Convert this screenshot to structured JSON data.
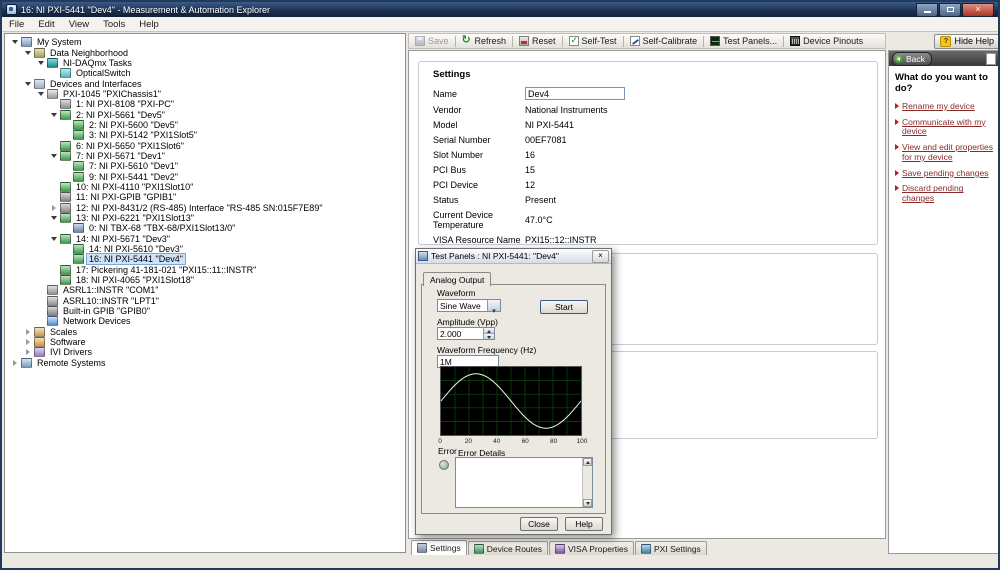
{
  "window": {
    "title": "16: NI PXI-5441 \"Dev4\" - Measurement & Automation Explorer"
  },
  "menu": {
    "items": [
      "File",
      "Edit",
      "View",
      "Tools",
      "Help"
    ]
  },
  "toolbar": {
    "save": "Save",
    "refresh": "Refresh",
    "reset": "Reset",
    "self_test": "Self-Test",
    "self_calibrate": "Self-Calibrate",
    "test_panels": "Test Panels...",
    "device_pinouts": "Device Pinouts"
  },
  "help": {
    "hide_help": "Hide Help",
    "back": "Back",
    "heading": "What do you want to do?",
    "links": [
      "Rename my device",
      "Communicate with my device",
      "View and edit properties for my device",
      "Save pending changes",
      "Discard pending changes"
    ]
  },
  "tree": {
    "items": [
      {
        "label": "My System",
        "depth": 0,
        "icon": "computer",
        "exp": "open"
      },
      {
        "label": "Data Neighborhood",
        "depth": 1,
        "icon": "folder-data",
        "exp": "open"
      },
      {
        "label": "NI-DAQmx Tasks",
        "depth": 2,
        "icon": "daqmx",
        "exp": "open"
      },
      {
        "label": "OpticalSwitch",
        "depth": 3,
        "icon": "task",
        "exp": "none"
      },
      {
        "label": "Devices and Interfaces",
        "depth": 1,
        "icon": "folder-devices",
        "exp": "open"
      },
      {
        "label": "PXI-1045 \"PXIChassis1\"",
        "depth": 2,
        "icon": "chassis",
        "exp": "open"
      },
      {
        "label": "1: NI PXI-8108 \"PXI-PC\"",
        "depth": 3,
        "icon": "controller",
        "exp": "none"
      },
      {
        "label": "2: NI PXI-5661 \"Dev5\"",
        "depth": 3,
        "icon": "board",
        "exp": "open"
      },
      {
        "label": "2: NI PXI-5600 \"Dev5\"",
        "depth": 4,
        "icon": "board",
        "exp": "none"
      },
      {
        "label": "3: NI PXI-5142 \"PXI1Slot5\"",
        "depth": 4,
        "icon": "board",
        "exp": "none"
      },
      {
        "label": "6: NI PXI-5650 \"PXI1Slot6\"",
        "depth": 3,
        "icon": "board",
        "exp": "none"
      },
      {
        "label": "7: NI PXI-5671 \"Dev1\"",
        "depth": 3,
        "icon": "board",
        "exp": "open"
      },
      {
        "label": "7: NI PXI-5610 \"Dev1\"",
        "depth": 4,
        "icon": "board",
        "exp": "none"
      },
      {
        "label": "9: NI PXI-5441 \"Dev2\"",
        "depth": 4,
        "icon": "board",
        "exp": "none"
      },
      {
        "label": "10: NI PXI-4110 \"PXI1Slot10\"",
        "depth": 3,
        "icon": "board",
        "exp": "none"
      },
      {
        "label": "11: NI PXI-GPIB \"GPIB1\"",
        "depth": 3,
        "icon": "gpib",
        "exp": "none"
      },
      {
        "label": "12: NI PXI-8431/2 (RS-485) Interface \"RS-485 SN:015F7E89\"",
        "depth": 3,
        "icon": "serial",
        "exp": "closed"
      },
      {
        "label": "13: NI PXI-6221 \"PXI1Slot13\"",
        "depth": 3,
        "icon": "board",
        "exp": "open"
      },
      {
        "label": "0: NI TBX-68 \"TBX-68/PXI1Slot13/0\"",
        "depth": 4,
        "icon": "accessory",
        "exp": "none"
      },
      {
        "label": "14: NI PXI-5671 \"Dev3\"",
        "depth": 3,
        "icon": "board",
        "exp": "open"
      },
      {
        "label": "14: NI PXI-5610 \"Dev3\"",
        "depth": 4,
        "icon": "board",
        "exp": "none"
      },
      {
        "label": "16: NI PXI-5441 \"Dev4\"",
        "depth": 4,
        "icon": "board",
        "exp": "none",
        "selected": true
      },
      {
        "label": "17: Pickering 41-181-021 \"PXI15::11::INSTR\"",
        "depth": 3,
        "icon": "board",
        "exp": "none"
      },
      {
        "label": "18: NI PXI-4065 \"PXI1Slot18\"",
        "depth": 3,
        "icon": "board",
        "exp": "none"
      },
      {
        "label": "ASRL1::INSTR \"COM1\"",
        "depth": 2,
        "icon": "serial-port",
        "exp": "none"
      },
      {
        "label": "ASRL10::INSTR \"LPT1\"",
        "depth": 2,
        "icon": "serial-port",
        "exp": "none"
      },
      {
        "label": "Built-in GPIB \"GPIB0\"",
        "depth": 2,
        "icon": "gpib",
        "exp": "none"
      },
      {
        "label": "Network Devices",
        "depth": 2,
        "icon": "network",
        "exp": "none"
      },
      {
        "label": "Scales",
        "depth": 1,
        "icon": "scales",
        "exp": "closed"
      },
      {
        "label": "Software",
        "depth": 1,
        "icon": "software",
        "exp": "closed"
      },
      {
        "label": "IVI Drivers",
        "depth": 1,
        "icon": "ivi",
        "exp": "closed"
      },
      {
        "label": "Remote Systems",
        "depth": 0,
        "icon": "remote",
        "exp": "closed"
      }
    ]
  },
  "settings": {
    "title": "Settings",
    "fields": [
      {
        "label": "Name",
        "value": "Dev4",
        "input": true
      },
      {
        "label": "Vendor",
        "value": "National Instruments"
      },
      {
        "label": "Model",
        "value": "NI PXI-5441"
      },
      {
        "label": "Serial Number",
        "value": "00EF7081"
      },
      {
        "label": "Slot Number",
        "value": "16"
      },
      {
        "label": "PCI Bus",
        "value": "15"
      },
      {
        "label": "PCI Device",
        "value": "12"
      },
      {
        "label": "Status",
        "value": "Present"
      },
      {
        "label": "Current Device Temperature",
        "value": "47.0°C"
      },
      {
        "label": "VISA Resource Name",
        "value": "PXI15::12::INSTR"
      }
    ]
  },
  "dialog": {
    "title": "Test Panels : NI PXI-5441: \"Dev4\"",
    "tab": "Analog Output",
    "waveform_label": "Waveform",
    "waveform_value": "Sine Wave",
    "start_button": "Start",
    "amplitude_label": "Amplitude (Vpp)",
    "amplitude_value": "2.000",
    "frequency_label": "Waveform Frequency (Hz)",
    "frequency_value": "1M",
    "error_label": "Error",
    "error_details_label": "Error Details",
    "close_button": "Close",
    "help_button": "Help",
    "chart": {
      "type": "line",
      "waveform": "sine",
      "cycles": 1,
      "xmin": 0,
      "xmax": 100,
      "xticks": [
        "0",
        "20",
        "40",
        "60",
        "80",
        "100"
      ],
      "amplitude_vpp": 2.0,
      "bg": "#000000",
      "grid_color": "#0c4d0c",
      "line_color": "#e8f8e8"
    }
  },
  "bottom_tabs": {
    "selected_index": 0,
    "items": [
      {
        "label": "Settings",
        "icon": "settings"
      },
      {
        "label": "Device Routes",
        "icon": "routes"
      },
      {
        "label": "VISA Properties",
        "icon": "visa"
      },
      {
        "label": "PXI Settings",
        "icon": "pxi"
      }
    ]
  }
}
